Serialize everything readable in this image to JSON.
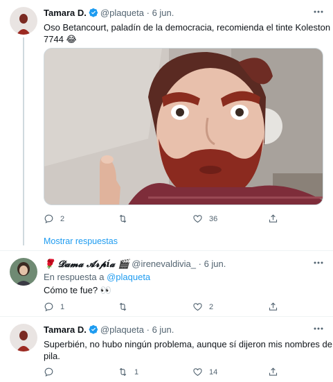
{
  "tweets": [
    {
      "name": "Tamara D.",
      "handle": "@plaqueta",
      "separator": "·",
      "date": "6 jun.",
      "text_line1": "Oso Betancourt, paladín de la democracia, recomienda el tinte Koleston",
      "text_line2": "7744 😂",
      "replies": "2",
      "retweets": "",
      "likes": "36"
    },
    {
      "name": "🌹 𝓓𝓪𝓶𝓪 𝓐𝓻𝓹í𝓪 🎬",
      "handle": "@irenevaldivia_",
      "separator": "·",
      "date": "6 jun.",
      "reply_prefix": "En respuesta a",
      "reply_handle": "@plaqueta",
      "text": "Cómo te fue? 👀",
      "replies": "1",
      "retweets": "",
      "likes": "2"
    },
    {
      "name": "Tamara D.",
      "handle": "@plaqueta",
      "separator": "·",
      "date": "6 jun.",
      "text_line1": "Superbién, no hubo ningún problema, aunque sí dijeron mis nombres de",
      "text_line2": "pila.",
      "replies": "",
      "retweets": "1",
      "likes": "14"
    }
  ],
  "show_replies": "Mostrar respuestas",
  "colors": {
    "accent": "#1d9bf0",
    "muted": "#536471",
    "text": "#0f1419"
  }
}
